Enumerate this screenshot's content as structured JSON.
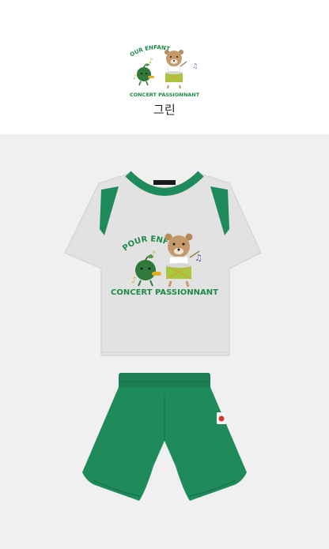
{
  "swatch": {
    "print_line_top": "OUR ENFANTS",
    "print_line_bottom": "CONCERT PASSIONNANT",
    "color_label": "그린"
  },
  "product": {
    "print_line_top": "POUR ENFANTS",
    "print_line_bottom": "CONCERT PASSIONNANT",
    "tshirt_body_color": "#e2e2e2",
    "accent_color": "#1f8a5a",
    "shorts_color": "#1f8a5a"
  }
}
